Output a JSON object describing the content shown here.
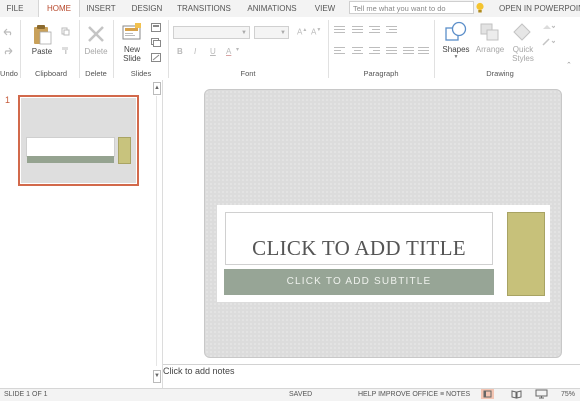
{
  "tabs": [
    {
      "label": "FILE"
    },
    {
      "label": "HOME"
    },
    {
      "label": "INSERT"
    },
    {
      "label": "DESIGN"
    },
    {
      "label": "TRANSITIONS"
    },
    {
      "label": "ANIMATIONS"
    },
    {
      "label": "VIEW"
    }
  ],
  "tell_me": {
    "placeholder": "Tell me what you want to do"
  },
  "open_in": "OPEN IN POWERPOINT",
  "ribbon": {
    "undo_group": "Undo",
    "clipboard": {
      "group": "Clipboard",
      "paste": "Paste"
    },
    "delete": {
      "group": "Delete",
      "label": "Delete"
    },
    "slides": {
      "group": "Slides",
      "new_slide_line1": "New",
      "new_slide_line2": "Slide"
    },
    "font": {
      "group": "Font"
    },
    "paragraph": {
      "group": "Paragraph"
    },
    "drawing": {
      "group": "Drawing",
      "shapes": "Shapes",
      "arrange": "Arrange",
      "quick_styles_line1": "Quick",
      "quick_styles_line2": "Styles"
    }
  },
  "thumbnails": [
    {
      "number": "1"
    }
  ],
  "slide": {
    "title_placeholder": "CLICK TO ADD TITLE",
    "subtitle_placeholder": "CLICK TO ADD SUBTITLE"
  },
  "notes_placeholder": "Click to add notes",
  "status": {
    "slide_counter": "SLIDE 1 OF 1",
    "saved": "SAVED",
    "help_improve": "HELP IMPROVE OFFICE",
    "notes_label": "NOTES",
    "zoom": "75%"
  },
  "colors": {
    "accent": "#b7472a",
    "subtitle_band": "#97a596",
    "gold_shape": "#c7c17a"
  }
}
